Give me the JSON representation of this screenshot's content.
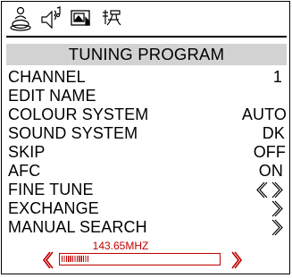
{
  "icons": [
    "picture-icon",
    "sound-icon",
    "program-icon",
    "function-icon"
  ],
  "menu_title": "TUNING PROGRAM",
  "items": [
    {
      "label": "CHANNEL",
      "value": "1"
    },
    {
      "label": "EDIT NAME",
      "value": ""
    },
    {
      "label": "COLOUR SYSTEM",
      "value": "AUTO"
    },
    {
      "label": "SOUND SYSTEM",
      "value": "DK"
    },
    {
      "label": "SKIP",
      "value": "OFF"
    },
    {
      "label": "AFC",
      "value": "ON"
    },
    {
      "label": "FINE TUNE",
      "value": ""
    },
    {
      "label": "EXCHANGE",
      "value": ""
    },
    {
      "label": "MANUAL SEARCH",
      "value": ""
    }
  ],
  "search": {
    "frequency": "143.65MHZ",
    "progress_fraction": 0.17
  },
  "colors": {
    "accent": "#c00000",
    "header_bg": "#d2d2d2"
  }
}
